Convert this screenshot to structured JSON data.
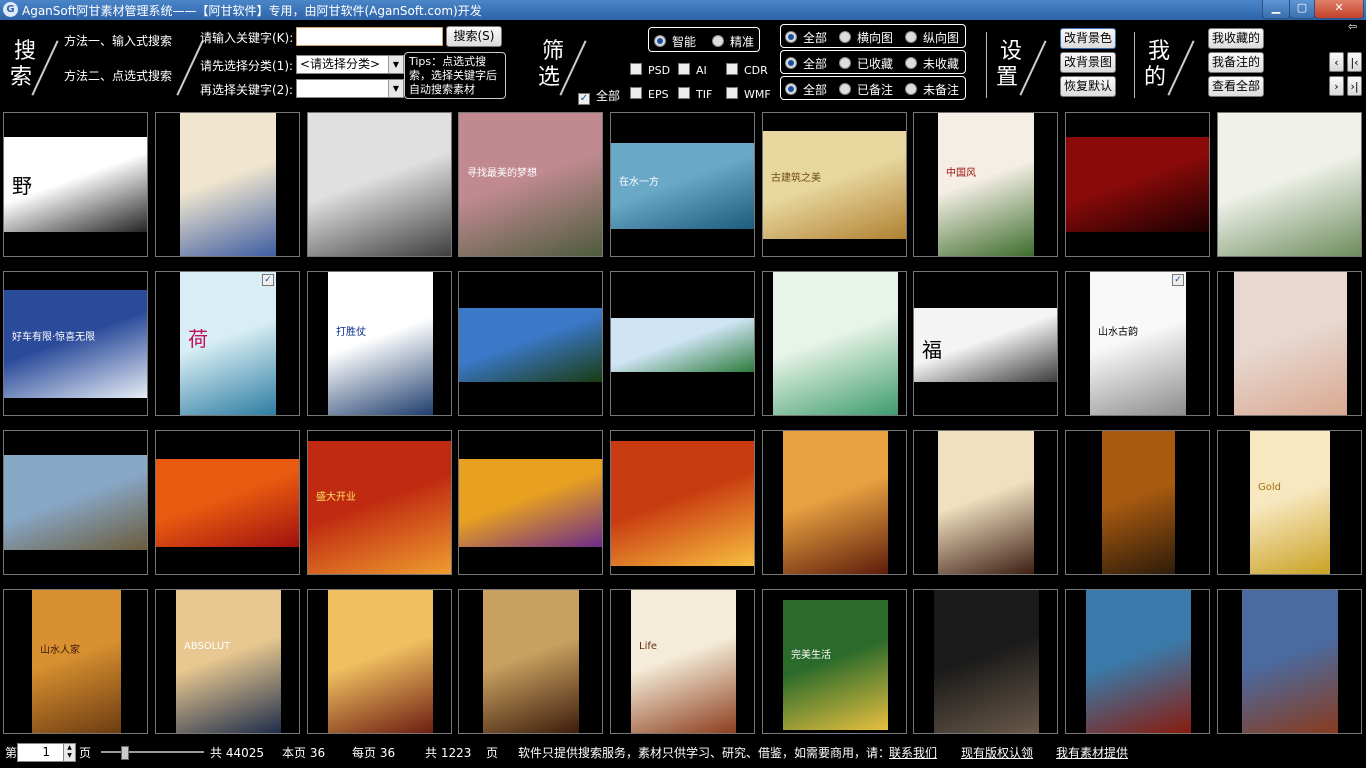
{
  "window": {
    "title": "AganSoft阿甘素材管理系统——【阿甘软件】专用，由阿甘软件(AganSoft.com)开发",
    "icon": "app-logo-icon",
    "min": "minimize-icon",
    "max": "maximize-icon",
    "close": "close-icon"
  },
  "search": {
    "big1": "搜",
    "big2": "索",
    "method1": "方法一、输入式搜索",
    "method2": "方法二、点选式搜索",
    "kw_label": "请输入关键字(K):",
    "kw_value": "",
    "search_btn": "搜索(S)",
    "cat_label": "请先选择分类(1):",
    "cat_value": "<请选择分类>",
    "kw2_label": "再选择关键字(2):",
    "kw2_value": "",
    "tips": "Tips：点选式搜索，选择关键字后自动搜索素材"
  },
  "filter": {
    "big1": "筛",
    "big2": "选",
    "mode": [
      {
        "label": "智能",
        "on": true
      },
      {
        "label": "精准",
        "on": false
      }
    ],
    "types": [
      "PSD",
      "AI",
      "CDR",
      "EPS",
      "TIF",
      "WMF"
    ],
    "all_label": "全部",
    "all_checked": true,
    "orient": [
      {
        "label": "全部",
        "on": true
      },
      {
        "label": "横向图",
        "on": false
      },
      {
        "label": "纵向图",
        "on": false
      }
    ],
    "fav": [
      {
        "label": "全部",
        "on": true
      },
      {
        "label": "已收藏",
        "on": false
      },
      {
        "label": "未收藏",
        "on": false
      }
    ],
    "note": [
      {
        "label": "全部",
        "on": true
      },
      {
        "label": "已备注",
        "on": false
      },
      {
        "label": "未备注",
        "on": false
      }
    ]
  },
  "settings": {
    "big1": "设",
    "big2": "置",
    "bg_color": "改背景色",
    "bg_image": "改背景图",
    "reset": "恢复默认"
  },
  "mine": {
    "big1": "我",
    "big2": "的",
    "favorites": "我收藏的",
    "notes": "我备注的",
    "all": "查看全部"
  },
  "nav": {
    "back": "‹",
    "first": "|‹",
    "next": "›",
    "last": "›|",
    "pin": "pin-icon"
  },
  "thumbs": [
    {
      "caption": "野",
      "c1": "#ffffff",
      "c2": "#222222",
      "tc": "#000000",
      "checked": false
    },
    {
      "caption": "",
      "c1": "#f0e6cf",
      "c2": "#3a5aa0",
      "tc": "#7a1a1a",
      "checked": false
    },
    {
      "caption": "",
      "c1": "#e0e0e0",
      "c2": "#3a3a3a",
      "tc": "#333333",
      "checked": false
    },
    {
      "caption": "寻找最美的梦想",
      "c1": "#c08a90",
      "c2": "#4a5a3a",
      "tc": "#ffffff",
      "checked": false
    },
    {
      "caption": "在水一方",
      "c1": "#6aa8c8",
      "c2": "#1a5a7a",
      "tc": "#ffffff",
      "checked": false
    },
    {
      "caption": "古建筑之美",
      "c1": "#e8d8a0",
      "c2": "#b08030",
      "tc": "#6a4a10",
      "checked": false
    },
    {
      "caption": "中国风",
      "c1": "#f4eee4",
      "c2": "#3a6a2a",
      "tc": "#a01010",
      "checked": false
    },
    {
      "caption": "",
      "c1": "#8a0a0a",
      "c2": "#1a0000",
      "tc": "#ffd070",
      "checked": false
    },
    {
      "caption": "",
      "c1": "#f0f2ea",
      "c2": "#6a8a5a",
      "tc": "#333333",
      "checked": false
    },
    {
      "caption": "好车有限·惊喜无限",
      "c1": "#2a4a9a",
      "c2": "#e8eef6",
      "tc": "#ffffff",
      "checked": false
    },
    {
      "caption": "荷",
      "c1": "#d8eef4",
      "c2": "#2a7aa0",
      "tc": "#c01060",
      "checked": true
    },
    {
      "caption": "打胜仗",
      "c1": "#ffffff",
      "c2": "#1a3a6a",
      "tc": "#0a2a8a",
      "checked": false
    },
    {
      "caption": "",
      "c1": "#3a78c8",
      "c2": "#1a3a10",
      "tc": "#ffffff",
      "checked": false
    },
    {
      "caption": "",
      "c1": "#cfe4f4",
      "c2": "#2a7a3a",
      "tc": "#ffffff",
      "checked": false
    },
    {
      "caption": "",
      "c1": "#e8f4e8",
      "c2": "#3a9a6a",
      "tc": "#1a5a3a",
      "checked": false
    },
    {
      "caption": "福",
      "c1": "#f4f4f4",
      "c2": "#3a3a3a",
      "tc": "#000000",
      "checked": false
    },
    {
      "caption": "山水古韵",
      "c1": "#f8f8f8",
      "c2": "#8a8a8a",
      "tc": "#000000",
      "checked": true
    },
    {
      "caption": "",
      "c1": "#e8d8d0",
      "c2": "#d8a890",
      "tc": "#5a3a2a",
      "checked": false
    },
    {
      "caption": "",
      "c1": "#88a8c8",
      "c2": "#6a5a3a",
      "tc": "#ffffff",
      "checked": false
    },
    {
      "caption": "",
      "c1": "#e85a10",
      "c2": "#a01010",
      "tc": "#ffe060",
      "checked": false
    },
    {
      "caption": "盛大开业",
      "c1": "#c02a10",
      "c2": "#f0a030",
      "tc": "#ffe060",
      "checked": false
    },
    {
      "caption": "",
      "c1": "#e8a020",
      "c2": "#6a2a8a",
      "tc": "#ffffff",
      "checked": false
    },
    {
      "caption": "",
      "c1": "#c83a10",
      "c2": "#f8c040",
      "tc": "#ffffff",
      "checked": false
    },
    {
      "caption": "",
      "c1": "#e8a040",
      "c2": "#5a1a0a",
      "tc": "#6a0a0a",
      "checked": false
    },
    {
      "caption": "",
      "c1": "#f0e0c0",
      "c2": "#3a1a10",
      "tc": "#5a2a10",
      "checked": false
    },
    {
      "caption": "",
      "c1": "#a85a10",
      "c2": "#2a1a0a",
      "tc": "#ffd070",
      "checked": false
    },
    {
      "caption": "Gold",
      "c1": "#f8e8c0",
      "c2": "#c8a020",
      "tc": "#a07010",
      "checked": false
    },
    {
      "caption": "山水人家",
      "c1": "#d89030",
      "c2": "#6a3a10",
      "tc": "#3a1a0a",
      "checked": false
    },
    {
      "caption": "ABSOLUT",
      "c1": "#e8c890",
      "c2": "#1a2a4a",
      "tc": "#ffffff",
      "checked": false
    },
    {
      "caption": "",
      "c1": "#f0c060",
      "c2": "#6a1a10",
      "tc": "#ffffff",
      "checked": false
    },
    {
      "caption": "",
      "c1": "#c8a060",
      "c2": "#3a1a0a",
      "tc": "#ffffff",
      "checked": false
    },
    {
      "caption": "Life",
      "c1": "#f4ecd8",
      "c2": "#8a3a1a",
      "tc": "#6a2a10",
      "checked": false
    },
    {
      "caption": "完美生活",
      "c1": "#2a6a2a",
      "c2": "#e8c040",
      "tc": "#ffffff",
      "checked": false
    },
    {
      "caption": "",
      "c1": "#1a1a1a",
      "c2": "#6a5a4a",
      "tc": "#ffffff",
      "checked": false
    },
    {
      "caption": "",
      "c1": "#3a7aaa",
      "c2": "#8a1a0a",
      "tc": "#ffd070",
      "checked": false
    },
    {
      "caption": "",
      "c1": "#4a6aa0",
      "c2": "#8a3a1a",
      "tc": "#ffffff",
      "checked": false
    }
  ],
  "status": {
    "page_prefix": "第",
    "page_value": "1",
    "page_suffix": "页",
    "total": "共 44025",
    "this_page": "本页 36",
    "per_page": "每页 36",
    "pages": "共 1223",
    "pages_unit": "页",
    "notice": "软件只提供搜索服务，素材只供学习、研究、借鉴，如需要商用，请：",
    "contact": "联系我们",
    "report": "现有版权认领",
    "provide": "我有素材提供"
  }
}
